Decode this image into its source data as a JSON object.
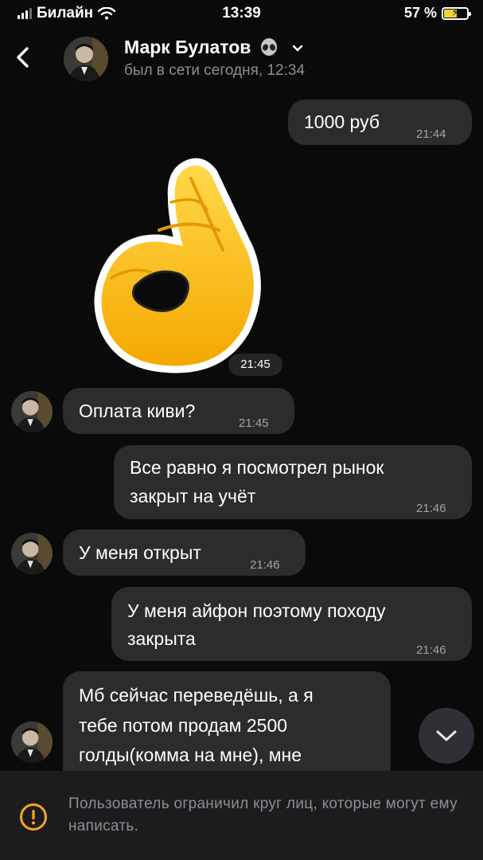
{
  "status_bar": {
    "carrier": "Билайн",
    "time": "13:39",
    "battery": "57 %"
  },
  "header": {
    "back_icon": "chevron-left-icon",
    "name": "Марк Булатов",
    "emoji_icon": "alien-icon",
    "status": "был в сети сегодня, 12:34"
  },
  "messages": [
    {
      "direction": "out",
      "text": "1000 руб",
      "time": "21:44"
    },
    {
      "direction": "in",
      "type": "sticker",
      "sticker_icon": "ok-hand-icon",
      "time": "21:45"
    },
    {
      "direction": "in",
      "text": "Оплата киви?",
      "time": "21:45"
    },
    {
      "direction": "out",
      "lines": [
        "Все равно я посмотрел рынок",
        "закрыт на учёт"
      ],
      "time": "21:46"
    },
    {
      "direction": "in",
      "text": "У меня открыт",
      "time": "21:46"
    },
    {
      "direction": "out",
      "lines": [
        "У меня айфон поэтому походу",
        "закрыта"
      ],
      "time": "21:46"
    },
    {
      "direction": "in",
      "lines": [
        "Мб сейчас переведёшь, а я",
        "тебе потом продам 2500",
        "голды(комма на мне), мне"
      ]
    }
  ],
  "restriction": {
    "icon": "warning-icon",
    "text": "Пользователь ограничил круг лиц, которые могут ему написать."
  },
  "colors": {
    "background": "#0a0a0a",
    "bubble": "#2c2c2e",
    "muted": "#8e8e93",
    "bar": "#1c1c1e"
  }
}
